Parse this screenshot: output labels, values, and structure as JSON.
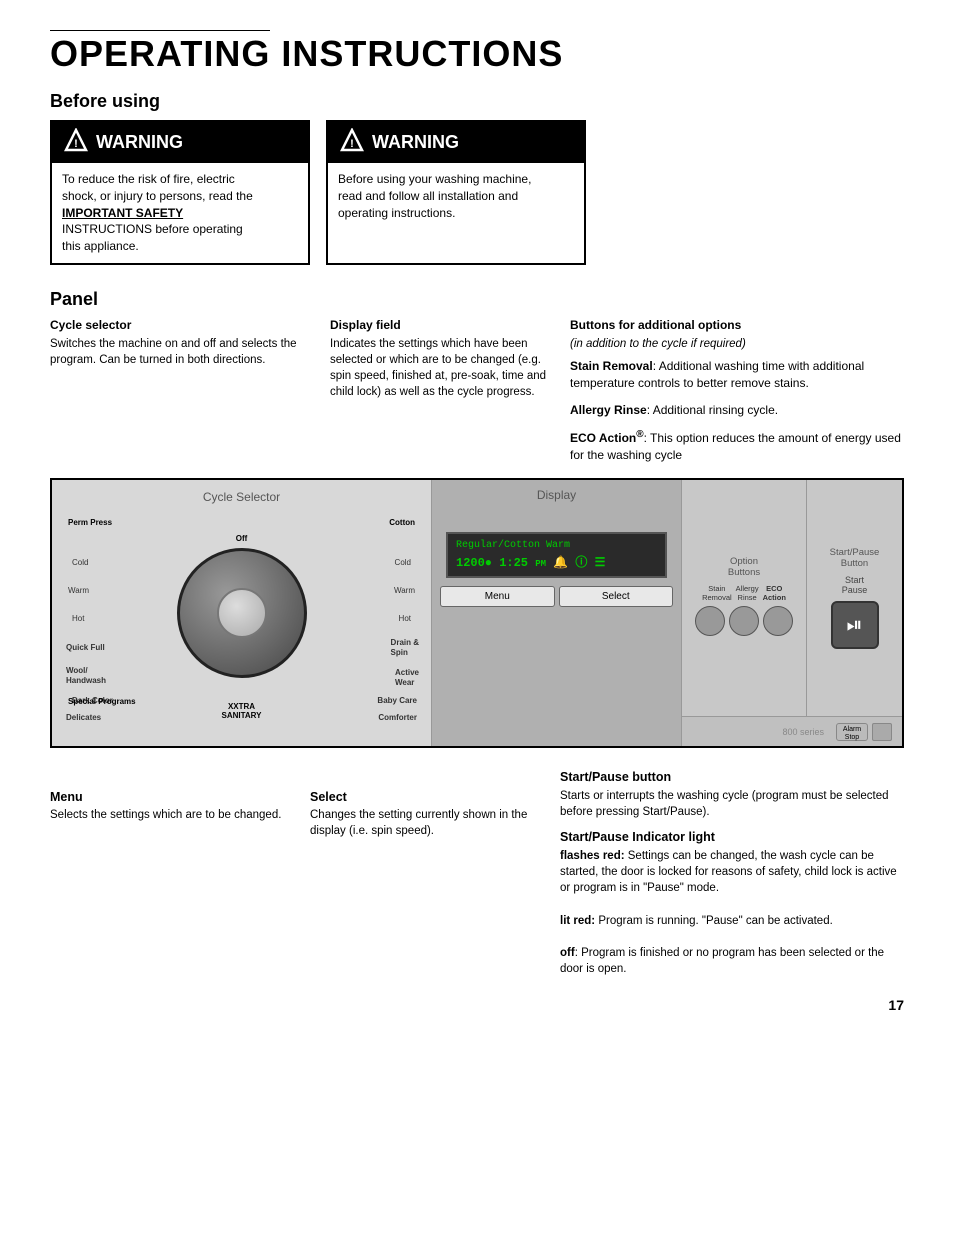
{
  "page": {
    "rule_visible": true,
    "title": "OPERATING INSTRUCTIONS",
    "page_number": "17"
  },
  "before_using": {
    "section_title": "Before using",
    "warning1": {
      "header": "WARNING",
      "body_line1": "To reduce the risk of fire, electric",
      "body_line2": "shock, or injury to persons, read the",
      "body_important": "IMPORTANT SAFETY",
      "body_line3": "INSTRUCTIONS before operating",
      "body_line4": "this appliance."
    },
    "warning2": {
      "header": "WARNING",
      "body_line1": "Before using your washing machine,",
      "body_line2": "read and follow all installation and",
      "body_line3": "operating instructions."
    }
  },
  "panel_section": {
    "section_title": "Panel",
    "cycle_selector_ann": {
      "title": "Cycle selector",
      "text": "Switches the machine on and off and selects the program. Can be turned in both directions."
    },
    "display_field_ann": {
      "title": "Display field",
      "text": "Indicates the settings which have been selected or which are to be changed (e.g. spin speed, finished at, pre-soak, time and child lock) as well as the cycle progress."
    },
    "buttons_ann": {
      "title": "Buttons for additional options",
      "subtitle": "(in addition to the cycle if required)",
      "stain_removal": {
        "label": "Stain Removal",
        "text": ": Additional washing time with additional temperature controls to better remove stains."
      },
      "allergy_rinse": {
        "label": "Allergy Rinse",
        "text": ": Additional rinsing cycle."
      },
      "eco_action": {
        "label": "ECO Action",
        "superscript": "®",
        "text": ": This option reduces the amount of energy used for the washing cycle"
      }
    }
  },
  "diagram": {
    "cycle_selector_label": "Cycle Selector",
    "display_label": "Display",
    "option_buttons_label": "Option\nButtons",
    "start_pause_label": "Start/Pause\nButton",
    "display_text_top": "Regular/Cotton Warm",
    "display_text_bottom": "1200● 1:25 PM 🔔 ① ⊟",
    "menu_btn": "Menu",
    "select_btn": "Select",
    "dial_programs": [
      {
        "label": "Perm Press",
        "position": "top-left"
      },
      {
        "label": "Cotton",
        "position": "top-right"
      },
      {
        "label": "Cold",
        "position": "upper-left"
      },
      {
        "label": "Cold",
        "position": "upper-right"
      },
      {
        "label": "Warm",
        "position": "mid-left"
      },
      {
        "label": "Warm",
        "position": "mid-right"
      },
      {
        "label": "Hot",
        "position": "lower-left"
      },
      {
        "label": "Hot",
        "position": "lower-right"
      },
      {
        "label": "Quick Full",
        "position": "left"
      },
      {
        "label": "Drain & Spin",
        "position": "right"
      },
      {
        "label": "Wool/Handwash",
        "position": "left-low"
      },
      {
        "label": "Active Wear",
        "position": "right-low"
      },
      {
        "label": "Dark Color",
        "position": "bottom-left"
      },
      {
        "label": "Baby Care",
        "position": "bottom-right"
      },
      {
        "label": "Delicates",
        "position": "bot-left2"
      },
      {
        "label": "Comforter",
        "position": "bot-right2"
      },
      {
        "label": "Special Programs",
        "position": "spec"
      },
      {
        "label": "XXTRA\nSANITARY",
        "position": "xxtra"
      },
      {
        "label": "Off",
        "position": "top-center"
      }
    ],
    "option_labels": [
      {
        "text": "Stain\nRemoval",
        "bold": false
      },
      {
        "text": "Allergy\nRinse",
        "bold": false
      },
      {
        "text": "ECO\nAction",
        "bold": true
      }
    ],
    "series_label": "800 series",
    "aux_buttons": [
      {
        "label": "Alarm\nStop"
      }
    ]
  },
  "below_panel": {
    "menu": {
      "title": "Menu",
      "text": "Selects the settings which are to be changed."
    },
    "select": {
      "title": "Select",
      "text": "Changes the setting currently shown in the display (i.e. spin speed)."
    },
    "start_pause_button": {
      "title": "Start/Pause button",
      "text": "Starts or interrupts the washing cycle (program must be selected before pressing Start/Pause)."
    },
    "start_pause_indicator": {
      "title": "Start/Pause Indicator light",
      "flashes_red_label": "flashes red:",
      "flashes_red_text": " Settings can be changed, the wash cycle can be started, the door is locked for reasons of safety, child lock is active or program is in \"Pause\" mode.",
      "lit_red_label": "lit red:",
      "lit_red_text": " Program is running. \"Pause\" can be activated.",
      "off_label": "off",
      "off_text": ": Program is finished or no program has been selected or the door is open."
    }
  }
}
